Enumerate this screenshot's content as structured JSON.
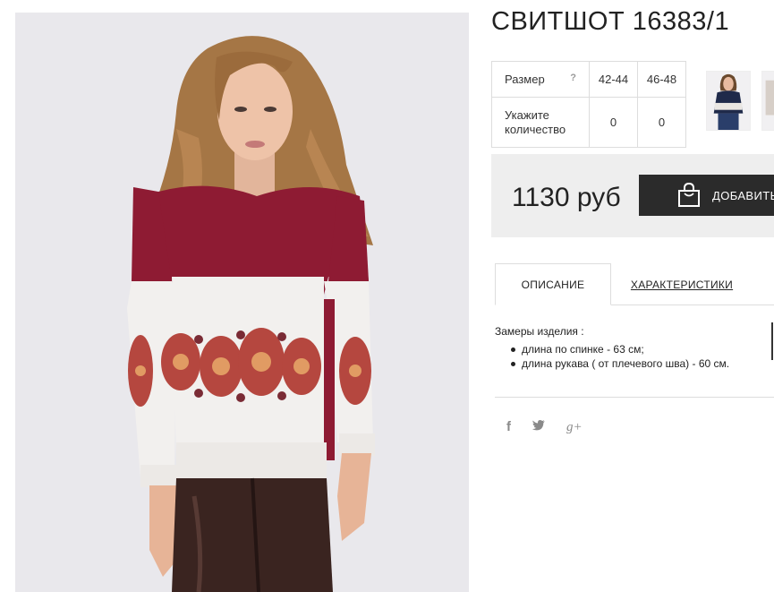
{
  "product": {
    "title": "СВИТШОТ 16383/1",
    "main_image_alt": "model wearing burgundy and white sweatshirt with floral print",
    "thumbnails": [
      "thumbnail-1",
      "thumbnail-2"
    ]
  },
  "sizes": {
    "size_label": "Размер",
    "help_symbol": "?",
    "quantity_label": "Укажите количество",
    "options": [
      {
        "size": "42-44",
        "quantity": "0"
      },
      {
        "size": "46-48",
        "quantity": "0"
      }
    ]
  },
  "purchase": {
    "price": "1130 руб",
    "add_button_label": "ДОБАВИТЬ"
  },
  "tabs": [
    {
      "label": "ОПИСАНИЕ",
      "active": true
    },
    {
      "label": "ХАРАКТЕРИСТИКИ",
      "active": false
    }
  ],
  "description": {
    "intro": "Замеры изделия :",
    "items": [
      "длина по спинке - 63 см;",
      "длина рукава ( от плечевого шва) - 60 см."
    ]
  },
  "social": {
    "facebook": "f",
    "twitter": "twitter-icon",
    "googleplus": "g+"
  },
  "colors": {
    "burgundy": "#8e1b33",
    "dark_button": "#2b2b2b",
    "price_bg": "#eeeeee"
  }
}
